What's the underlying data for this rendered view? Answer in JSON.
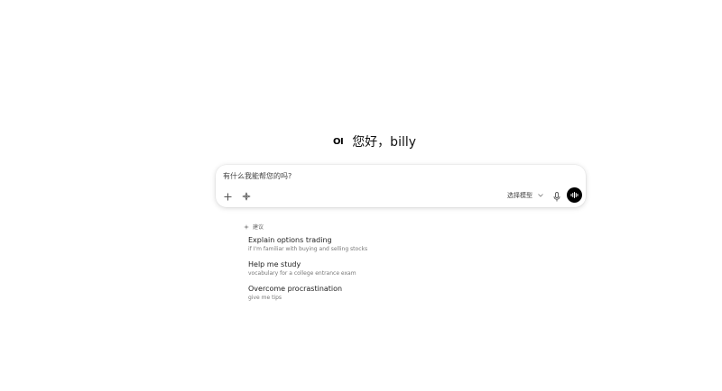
{
  "greeting": {
    "logo": "OI",
    "text": "您好，billy"
  },
  "chat": {
    "placeholder": "有什么我能帮您的吗?",
    "value": "",
    "model_label": "选择模型",
    "icons": {
      "add": "plus-icon",
      "tools": "tools-icon",
      "dropdown": "chevron-down-icon",
      "mic": "microphone-icon",
      "voice": "voice-waveform-icon"
    }
  },
  "suggestions": {
    "header": "建议",
    "items": [
      {
        "title": "Explain options trading",
        "subtitle": "if I'm familiar with buying and selling stocks"
      },
      {
        "title": "Help me study",
        "subtitle": "vocabulary for a college entrance exam"
      },
      {
        "title": "Overcome procrastination",
        "subtitle": "give me tips"
      }
    ]
  },
  "colors": {
    "background": "#ffffff",
    "accent": "#000000",
    "muted_text": "#777777"
  }
}
